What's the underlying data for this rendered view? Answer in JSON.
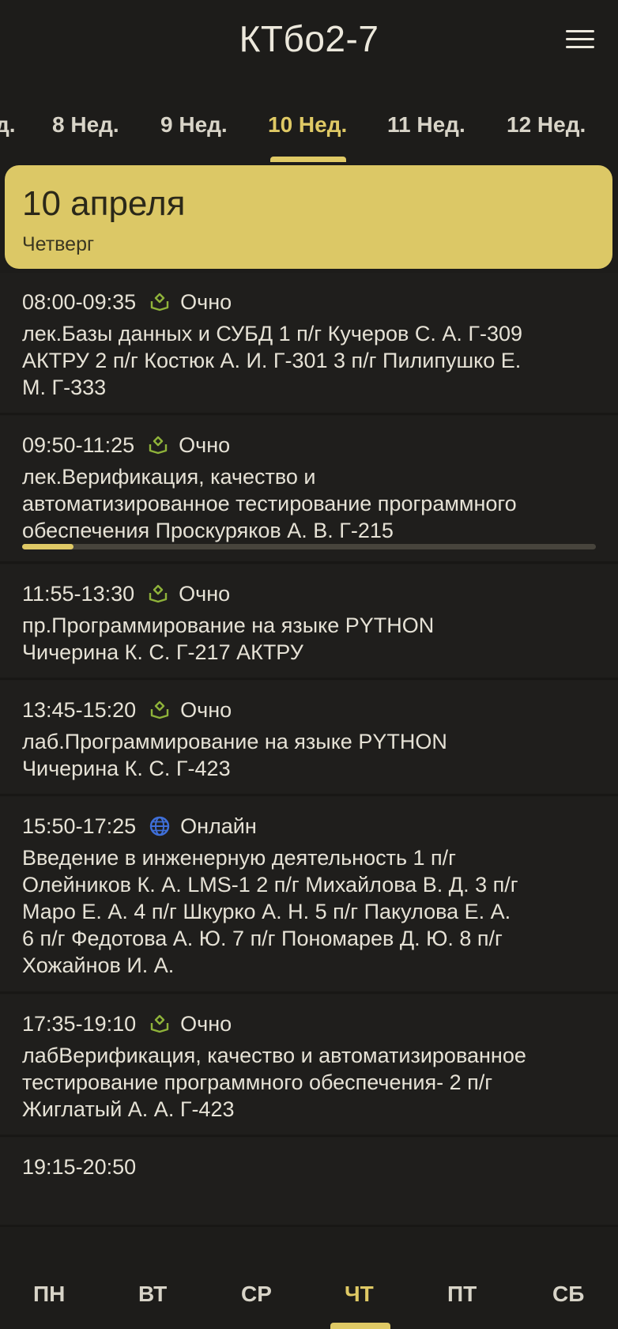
{
  "header": {
    "title": "КТбо2-7",
    "menu_icon": "hamburger-menu-icon"
  },
  "weeks": {
    "tabs": [
      "д.",
      "8 Нед.",
      "9 Нед.",
      "10 Нед.",
      "11 Нед.",
      "12 Нед."
    ],
    "active_index": 3
  },
  "date_card": {
    "date": "10 апреля",
    "weekday": "Четверг"
  },
  "lessons": [
    {
      "time": "08:00-09:35",
      "mode": "Очно",
      "mode_icon": "in-person-icon",
      "text": "лек.Базы данных и СУБД 1 п/г Кучеров С. А. Г-309\nАКТРУ 2 п/г Костюк А. И. Г-301 3 п/г Пилипушко Е.\nМ. Г-333"
    },
    {
      "time": "09:50-11:25",
      "mode": "Очно",
      "mode_icon": "in-person-icon",
      "text": "лек.Верификация, качество и\nавтоматизированное тестирование программного\nобеспечения Проскуряков А. В. Г-215",
      "progress": 0.09
    },
    {
      "time": "11:55-13:30",
      "mode": "Очно",
      "mode_icon": "in-person-icon",
      "text": "пр.Программирование на языке PYTHON\nЧичерина К. С. Г-217 АКТРУ"
    },
    {
      "time": "13:45-15:20",
      "mode": "Очно",
      "mode_icon": "in-person-icon",
      "text": "лаб.Программирование на языке PYTHON\nЧичерина К. С. Г-423"
    },
    {
      "time": "15:50-17:25",
      "mode": "Онлайн",
      "mode_icon": "globe-icon",
      "text": "Введение в инженерную деятельность 1 п/г\nОлейников К. А. LMS-1 2 п/г Михайлова В. Д.  3 п/г\nМаро Е. А.  4 п/г Шкурко А. Н.  5 п/г Пакулова Е. А.\n6 п/г Федотова А. Ю.  7 п/г Пономарев Д. Ю.  8 п/г\nХожайнов И. А."
    },
    {
      "time": "17:35-19:10",
      "mode": "Очно",
      "mode_icon": "in-person-icon",
      "text": "лабВерификация, качество и автоматизированное\nтестирование программного обеспечения- 2 п/г\nЖиглатый А. А. Г-423"
    },
    {
      "time": "19:15-20:50",
      "mode": "",
      "mode_icon": "",
      "text": ""
    }
  ],
  "days": {
    "tabs": [
      "ПН",
      "ВТ",
      "СР",
      "ЧТ",
      "ПТ",
      "СБ"
    ],
    "active_index": 3
  },
  "colors": {
    "accent": "#dfc965",
    "background": "#1d1c1a",
    "online": "#3f6fd8",
    "in_person": "#8fb33a"
  }
}
